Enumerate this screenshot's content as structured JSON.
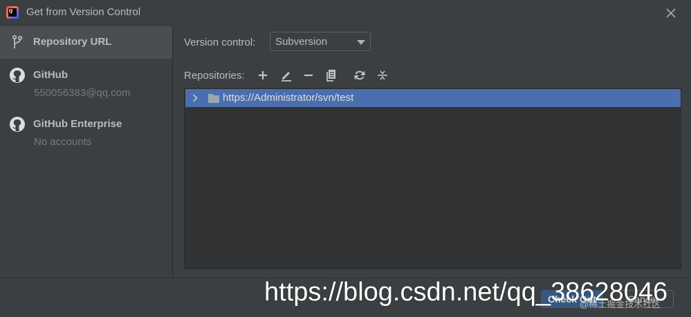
{
  "window": {
    "title": "Get from Version Control",
    "app_icon_text": "IJ"
  },
  "sidebar": {
    "items": [
      {
        "label": "Repository URL",
        "sub": "",
        "icon": "vcs-branch-icon",
        "selected": true
      },
      {
        "label": "GitHub",
        "sub": "550056383@qq.com",
        "icon": "github-icon",
        "selected": false
      },
      {
        "label": "GitHub Enterprise",
        "sub": "No accounts",
        "icon": "github-icon",
        "selected": false
      }
    ]
  },
  "main": {
    "version_control_label": "Version control:",
    "version_control_value": "Subversion",
    "repositories_label": "Repositories:",
    "toolbar_icons": [
      "add-icon",
      "edit-icon",
      "remove-icon",
      "copy-icon",
      "refresh-icon",
      "collapse-all-icon"
    ],
    "repositories": [
      {
        "url": "https://Administrator/svn/test",
        "selected": true
      }
    ]
  },
  "buttons": {
    "checkout": "Check Out",
    "cancel": "Cancel"
  },
  "watermark": {
    "url": "https://blog.csdn.net/qq_38628046",
    "credit": "@稀土掘金技术社区"
  },
  "colors": {
    "background": "#3c3f41",
    "selection": "#4b6eaf",
    "sidebar_selected": "#4b4e50",
    "primary_button": "#365880"
  }
}
